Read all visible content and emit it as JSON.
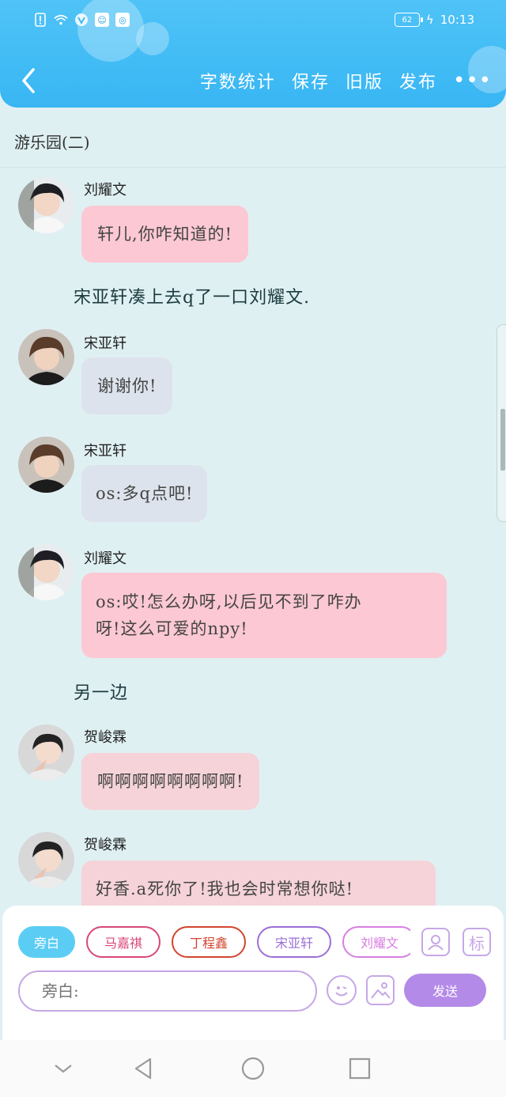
{
  "status_bar": {
    "battery": "62",
    "time": "10:13"
  },
  "header": {
    "actions": [
      "字数统计",
      "保存",
      "旧版",
      "发布"
    ],
    "more": "•••"
  },
  "title": "游乐园(二)",
  "messages": [
    {
      "type": "chat",
      "sender": "刘耀文",
      "text": "轩儿,你咋知道的!",
      "style": "pink"
    },
    {
      "type": "narration",
      "text": "宋亚轩凑上去q了一口刘耀文."
    },
    {
      "type": "chat",
      "sender": "宋亚轩",
      "text": "谢谢你!",
      "style": "grey"
    },
    {
      "type": "chat",
      "sender": "宋亚轩",
      "text": "os:多q点吧!",
      "style": "grey"
    },
    {
      "type": "chat",
      "sender": "刘耀文",
      "text_lines": [
        "os:哎!怎么办呀,以后见不到了咋办",
        "呀!这么可爱的npy!"
      ],
      "style": "pink"
    },
    {
      "type": "narration",
      "text": "另一边"
    },
    {
      "type": "chat",
      "sender": "贺峻霖",
      "text": "啊啊啊啊啊啊啊啊!",
      "style": "pinkgrey"
    },
    {
      "type": "chat",
      "sender": "贺峻霖",
      "text": "好香.a死你了!我也会时常想你哒!",
      "style": "pinkgrey"
    }
  ],
  "composer": {
    "roles": [
      {
        "label": "旁白",
        "color": "#5bcdf5"
      },
      {
        "label": "马嘉祺",
        "color": "#d9477a"
      },
      {
        "label": "丁程鑫",
        "color": "#d2452f"
      },
      {
        "label": "宋亚轩",
        "color": "#9b6fd6"
      },
      {
        "label": "刘耀文",
        "color": "#d77fe0"
      }
    ],
    "placeholder": "旁白:",
    "send_label": "发送",
    "tag_label": "标"
  },
  "colors": {
    "header": "#38b6f3",
    "background": "#dff0f3",
    "accent_purple": "#b48ae8"
  }
}
